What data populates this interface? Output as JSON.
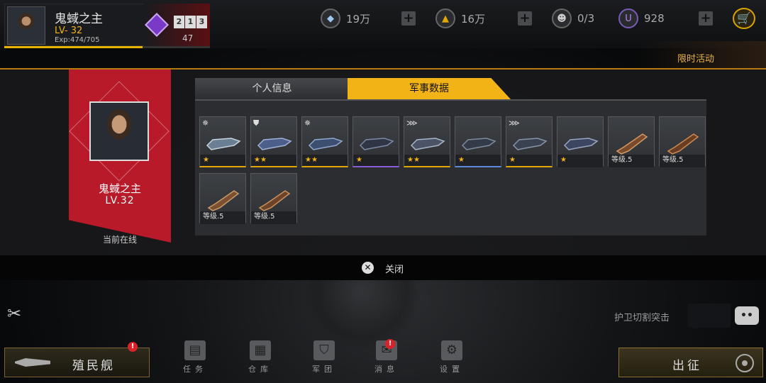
{
  "player": {
    "name": "鬼蜮之主",
    "level": "LV- 32",
    "exp": "Exp:474/705",
    "exp_fraction": 0.672,
    "rank_digits": [
      "2",
      "1",
      "3"
    ],
    "rank": "47"
  },
  "resources": [
    {
      "icon": "crystal-icon",
      "value": "19万"
    },
    {
      "icon": "gold-icon",
      "value": "16万"
    },
    {
      "icon": "pilot-icon",
      "value": "0/3"
    },
    {
      "icon": "u-coin-icon",
      "value": "928"
    }
  ],
  "event_label": "限时活动",
  "profile_card": {
    "name": "鬼蜮之主",
    "level": "LV.32",
    "status": "当前在线"
  },
  "tabs": {
    "personal": "个人信息",
    "military": "军事数据"
  },
  "weapons": [
    {
      "corner": "star-burst-icon",
      "foot": "★",
      "tier": "gold"
    },
    {
      "corner": "shield-badge-icon",
      "foot": "★★",
      "tier": "gold"
    },
    {
      "corner": "star-burst-icon",
      "foot": "★★",
      "tier": "gold"
    },
    {
      "corner": "",
      "foot": "★",
      "tier": "purple"
    },
    {
      "corner": "rank-chevron-icon",
      "foot": "★★",
      "tier": "gold"
    },
    {
      "corner": "",
      "foot": "★",
      "tier": "blue"
    },
    {
      "corner": "rank-chevron-icon",
      "foot": "★",
      "tier": "gold"
    },
    {
      "corner": "",
      "foot": "★",
      "tier": "none"
    },
    {
      "corner": "",
      "foot": "等级.5",
      "tier": "none"
    },
    {
      "corner": "",
      "foot": "等级.5",
      "tier": "none"
    },
    {
      "corner": "",
      "foot": "等级.5",
      "tier": "none"
    },
    {
      "corner": "",
      "foot": "等级.5",
      "tier": "none"
    }
  ],
  "close_label": "关闭",
  "escort_label": "护卫切割突击",
  "bottom_nav": {
    "colony": "殖民舰",
    "colony_badge": "!",
    "items": [
      {
        "label": "任务",
        "icon": "task-icon"
      },
      {
        "label": "仓库",
        "icon": "warehouse-icon"
      },
      {
        "label": "军团",
        "icon": "legion-icon"
      },
      {
        "label": "消息",
        "icon": "mail-icon",
        "badge": "!"
      },
      {
        "label": "设置",
        "icon": "settings-icon"
      }
    ],
    "go": "出征"
  },
  "colors": {
    "accent": "#f2b316",
    "ribbon": "#b81a2a",
    "badge": "#d8232a"
  }
}
